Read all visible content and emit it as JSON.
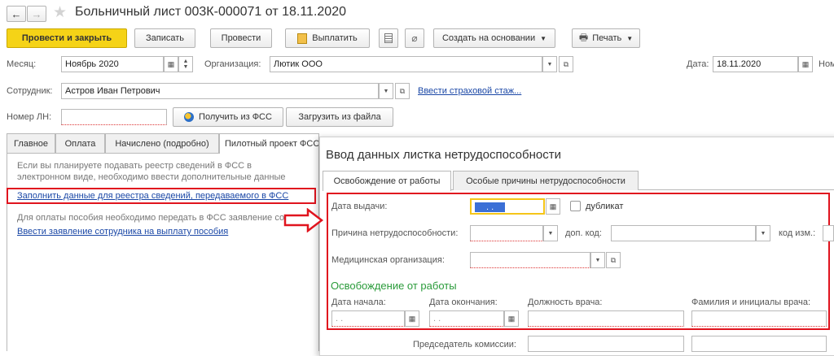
{
  "nav": {
    "back": "←",
    "forward": "→",
    "star": "★"
  },
  "window": {
    "title": "Больничный лист 003К-000071 от 18.11.2020"
  },
  "toolbar": {
    "post_close": "Провести и закрыть",
    "save": "Записать",
    "post": "Провести",
    "pay": "Выплатить",
    "create_based": "Создать на основании",
    "print": "Печать"
  },
  "header": {
    "month_label": "Месяц:",
    "month_value": "Ноябрь 2020",
    "org_label": "Организация:",
    "org_value": "Лютик ООО",
    "date_label": "Дата:",
    "date_value": "18.11.2020",
    "number_cut": "Ном",
    "employee_label": "Сотрудник:",
    "employee_value": "Астров Иван Петрович",
    "insurance_link": "Ввести страховой стаж...",
    "ln_label": "Номер ЛН:",
    "get_fss": "Получить из ФСС",
    "load_file": "Загрузить из файла"
  },
  "tabs": [
    "Главное",
    "Оплата",
    "Начислено (подробно)",
    "Пилотный проект ФСС"
  ],
  "pilot": {
    "info": "Если вы планируете подавать реестр сведений в ФСС в электронном виде, необходимо ввести дополнительные данные",
    "fill_link": "Заполнить данные для реестра сведений, передаваемого в ФСС",
    "pay_info": "Для оплаты пособия необходимо передать в ФСС заявление сотр",
    "statement_link": "Ввести заявление сотрудника на выплату пособия"
  },
  "dialog": {
    "title": "Ввод данных листка нетрудоспособности",
    "tabs": [
      "Освобождение от работы",
      "Особые причины нетрудоспособности"
    ],
    "issue_date_label": "Дата выдачи:",
    "issue_date_value": ". .",
    "duplicate_label": "дубликат",
    "reason_label": "Причина нетрудоспособности:",
    "add_code_label": "доп. код:",
    "change_code_label": "код изм.:",
    "med_org_label": "Медицинская организация:",
    "section_title": "Освобождение от работы",
    "start_label": "Дата начала:",
    "end_label": "Дата окончания:",
    "doctor_pos_label": "Должность врача:",
    "doctor_name_label": "Фамилия и инициалы врача:",
    "start_value": ". .",
    "end_value": ". .",
    "chairman_label": "Председатель комиссии:"
  },
  "colors": {
    "accent_yellow": "#f5d317",
    "highlight_red": "#e0141e",
    "link_blue": "#1a47a6",
    "section_green": "#2a9b3a"
  }
}
